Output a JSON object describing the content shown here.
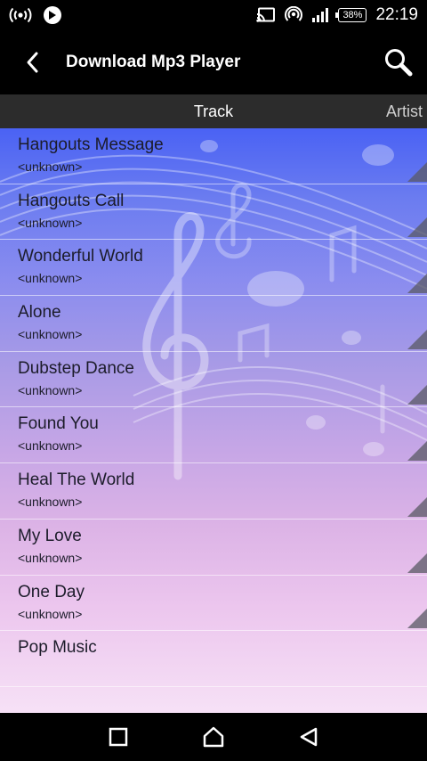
{
  "status_bar": {
    "battery": "38%",
    "time": "22:19",
    "icons": [
      "wireless-signal-icon",
      "notification-app-icon",
      "cast-icon",
      "hotspot-icon",
      "cell-signal-icon",
      "battery-icon"
    ]
  },
  "app_bar": {
    "title": "Download Mp3 Player",
    "back_icon": "back-chevron-icon",
    "search_icon": "search-icon"
  },
  "tabs": [
    {
      "label": "Track",
      "selected": true
    },
    {
      "label": "Artist",
      "selected": false
    }
  ],
  "tracks": [
    {
      "title": "Hangouts Message",
      "artist": "<unknown>"
    },
    {
      "title": "Hangouts Call",
      "artist": "<unknown>"
    },
    {
      "title": "Wonderful World",
      "artist": "<unknown>"
    },
    {
      "title": "Alone",
      "artist": "<unknown>"
    },
    {
      "title": "Dubstep Dance",
      "artist": "<unknown>"
    },
    {
      "title": "Found You",
      "artist": "<unknown>"
    },
    {
      "title": "Heal The World",
      "artist": "<unknown>"
    },
    {
      "title": "My Love",
      "artist": "<unknown>"
    },
    {
      "title": "One Day",
      "artist": "<unknown>"
    },
    {
      "title": "Pop Music",
      "artist": ""
    }
  ],
  "nav_bar": {
    "icons": [
      "recents-square-icon",
      "home-icon",
      "back-triangle-icon"
    ]
  },
  "colors": {
    "list_top": "#4a62f4",
    "list_bottom": "#f6e1f6",
    "tab_bar": "#2c2c2c",
    "text": "#1c1c2a"
  }
}
